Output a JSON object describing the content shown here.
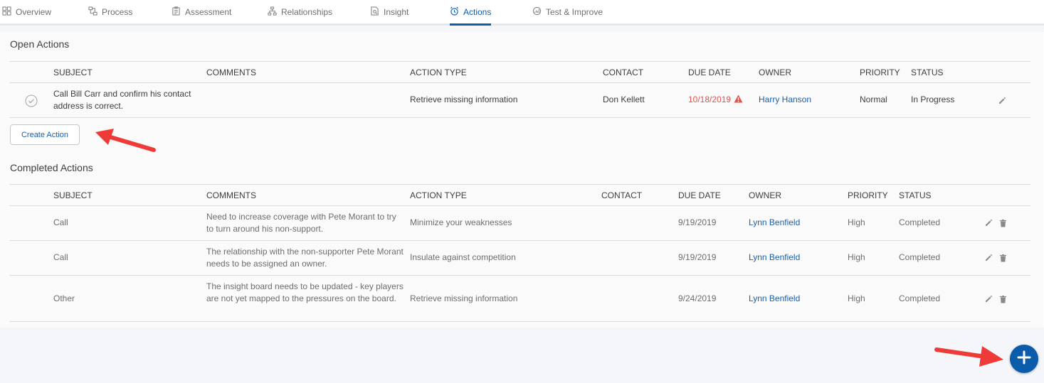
{
  "tabs": [
    {
      "label": "Overview",
      "icon": "grid-icon"
    },
    {
      "label": "Process",
      "icon": "process-icon"
    },
    {
      "label": "Assessment",
      "icon": "clipboard-icon"
    },
    {
      "label": "Relationships",
      "icon": "hierarchy-icon"
    },
    {
      "label": "Insight",
      "icon": "insight-icon"
    },
    {
      "label": "Actions",
      "icon": "alarm-clock-icon",
      "active": true
    },
    {
      "label": "Test & Improve",
      "icon": "test-improve-icon"
    }
  ],
  "open_actions": {
    "title": "Open Actions",
    "columns": [
      "SUBJECT",
      "COMMENTS",
      "ACTION TYPE",
      "CONTACT",
      "DUE DATE",
      "OWNER",
      "PRIORITY",
      "STATUS"
    ],
    "rows": [
      {
        "subject": "Call Bill Carr and confirm his contact address is correct.",
        "comments": "",
        "action_type": "Retrieve missing information",
        "contact": "Don Kellett",
        "due_date": "10/18/2019",
        "owner": "Harry Hanson",
        "priority": "Normal",
        "status": "In Progress"
      }
    ],
    "create_button": "Create Action"
  },
  "completed_actions": {
    "title": "Completed Actions",
    "columns": [
      "SUBJECT",
      "COMMENTS",
      "ACTION TYPE",
      "CONTACT",
      "DUE DATE",
      "OWNER",
      "PRIORITY",
      "STATUS"
    ],
    "rows": [
      {
        "subject": "Call",
        "comments": "Need to increase coverage with Pete Morant to try to turn around his non-support.",
        "action_type": "Minimize your weaknesses",
        "contact": "",
        "due_date": "9/19/2019",
        "owner": "Lynn Benfield",
        "priority": "High",
        "status": "Completed"
      },
      {
        "subject": "Call",
        "comments": "The relationship with the non-supporter Pete Morant needs to be assigned an owner.",
        "action_type": "Insulate against competition",
        "contact": "",
        "due_date": "9/19/2019",
        "owner": "Lynn Benfield",
        "priority": "High",
        "status": "Completed"
      },
      {
        "subject": "Other",
        "comments": "The insight board needs to be updated - key players are not yet mapped to the pressures on the board.",
        "action_type": "Retrieve missing information",
        "contact": "",
        "due_date": "9/24/2019",
        "owner": "Lynn Benfield",
        "priority": "High",
        "status": "Completed"
      }
    ]
  },
  "colors": {
    "accent": "#0b5cab",
    "link": "#1b5faa",
    "overdue": "#e0524b",
    "annotation_arrow": "#ee3b37"
  }
}
